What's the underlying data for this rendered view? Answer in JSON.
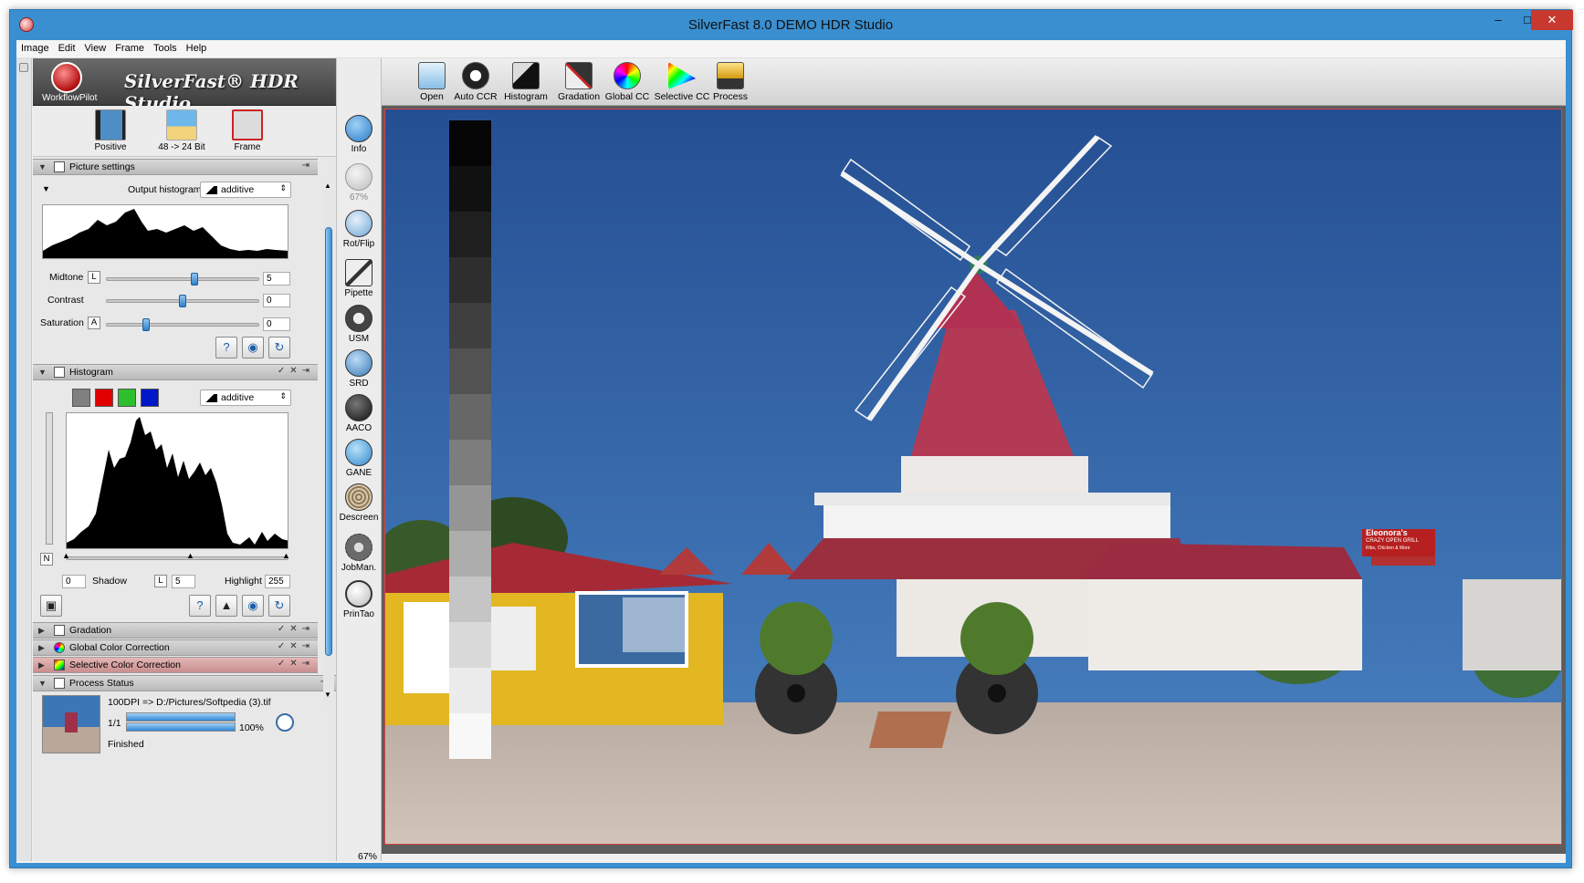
{
  "window": {
    "title": "SilverFast 8.0 DEMO  HDR Studio",
    "minimize": "–",
    "maximize": "□",
    "close": "✕"
  },
  "menu": [
    "Image",
    "Edit",
    "View",
    "Frame",
    "Tools",
    "Help"
  ],
  "brand": {
    "workflow_label": "WorkflowPilot",
    "product": "SilverFast® HDR Studio"
  },
  "top_tools": [
    {
      "label": "Positive",
      "icon": "film-strip-icon"
    },
    {
      "label": "48 -> 24 Bit",
      "icon": "palm-beach-icon"
    },
    {
      "label": "Frame",
      "icon": "frame-tools-icon"
    }
  ],
  "picture_settings": {
    "header": "Picture settings",
    "output_histogram_label": "Output histogram",
    "output_histogram_value": "additive",
    "midtone": {
      "label": "Midtone",
      "key": "L",
      "value": "5",
      "level": 0.58
    },
    "contrast": {
      "label": "Contrast",
      "key": "",
      "value": "0",
      "level": 0.5
    },
    "saturation": {
      "label": "Saturation",
      "key": "A",
      "value": "0",
      "level": 0.26
    }
  },
  "histogram": {
    "header": "Histogram",
    "mode_value": "additive",
    "shadow_value": "0",
    "shadow_label": "Shadow",
    "key": "L",
    "key_value": "5",
    "highlight_label": "Highlight",
    "highlight_value": "255",
    "neutral_key": "N"
  },
  "collapsed_sections": [
    {
      "name": "Gradation",
      "style": "normal"
    },
    {
      "name": "Global Color Correction",
      "style": "normal"
    },
    {
      "name": "Selective Color Correction",
      "style": "selective"
    }
  ],
  "process_status": {
    "header": "Process Status",
    "line": "100DPI => D:/Pictures/Softpedia (3).tif",
    "count": "1/1",
    "percent": "100%",
    "progress": 1.0,
    "state": "Finished"
  },
  "side_tools": [
    {
      "label": "Info",
      "icon": "info-icon",
      "color": "#2a7cc7"
    },
    {
      "label": "67%",
      "icon": "zoom-icon",
      "color": "#bdbdbd"
    },
    {
      "label": "Rot/Flip",
      "icon": "rotate-flip-icon",
      "color": "#6fa6d6"
    },
    {
      "label": "Pipette",
      "icon": "pipette-icon",
      "color": "#333333"
    },
    {
      "label": "USM",
      "icon": "usm-icon",
      "color": "#444444"
    },
    {
      "label": "SRD",
      "icon": "srd-icon",
      "color": "#3b79b8"
    },
    {
      "label": "AACO",
      "icon": "aaco-icon",
      "color": "#222222"
    },
    {
      "label": "GANE",
      "icon": "gane-icon",
      "color": "#2f8acd"
    },
    {
      "label": "Descreen",
      "icon": "descreen-icon",
      "color": "#9a8a70"
    },
    {
      "label": "JobMan.",
      "icon": "job-manager-icon",
      "color": "#6a6a6a"
    },
    {
      "label": "PrinTao",
      "icon": "printao-icon",
      "color": "#2a2a2a"
    }
  ],
  "main_tools": [
    {
      "label": "Open",
      "icon": "open-icon"
    },
    {
      "label": "Auto CCR",
      "icon": "auto-ccr-icon"
    },
    {
      "label": "Histogram",
      "icon": "histogram-icon"
    },
    {
      "label": "Gradation",
      "icon": "gradation-icon"
    },
    {
      "label": "Global CC",
      "icon": "global-cc-icon"
    },
    {
      "label": "Selective CC",
      "icon": "selective-cc-icon"
    },
    {
      "label": "Process",
      "icon": "process-icon"
    }
  ],
  "zoom_label": "67%",
  "photo_signs": {
    "shop": "Eleonora's",
    "tagline": "CRAZY OPEN GRILL",
    "sub": "Ribs, Chicken & More"
  }
}
